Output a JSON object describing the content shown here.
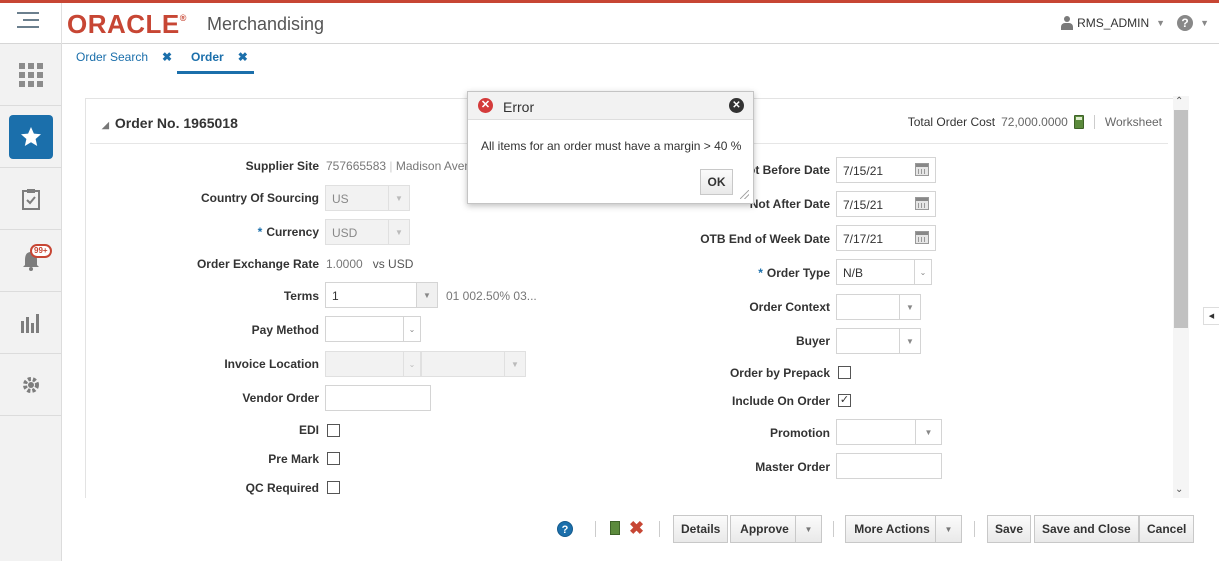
{
  "header": {
    "logo_text": "ORACLE",
    "app_name": "Merchandising",
    "user_name": "RMS_ADMIN"
  },
  "tabs": [
    {
      "label": "Order Search"
    },
    {
      "label": "Order"
    }
  ],
  "sidebar": {
    "badge": "99+"
  },
  "section": {
    "title": "Order No. 1965018",
    "total_cost_label": "Total Order Cost",
    "total_cost_value": "72,000.0000",
    "status": "Worksheet"
  },
  "form_left": {
    "supplier_site": {
      "label": "Supplier Site",
      "value": "757665583",
      "extra": "Madison Aven"
    },
    "country_of_sourcing": {
      "label": "Country Of Sourcing",
      "value": "US"
    },
    "currency": {
      "label": "Currency",
      "value": "USD",
      "required_mark": "*"
    },
    "exchange_rate": {
      "label": "Order Exchange Rate",
      "value": "1.0000",
      "suffix": "vs USD"
    },
    "terms": {
      "label": "Terms",
      "value": "1",
      "description": "01 002.50% 03..."
    },
    "pay_method": {
      "label": "Pay Method",
      "value": ""
    },
    "invoice_location": {
      "label": "Invoice Location",
      "value": ""
    },
    "vendor_order": {
      "label": "Vendor Order",
      "value": ""
    },
    "edi": {
      "label": "EDI",
      "checked": false
    },
    "pre_mark": {
      "label": "Pre Mark",
      "checked": false
    },
    "qc_required": {
      "label": "QC Required",
      "checked": false
    }
  },
  "form_right": {
    "not_before_date": {
      "label": "ot Before Date",
      "value": "7/15/21"
    },
    "not_after_date": {
      "label": "Not After Date",
      "value": "7/15/21"
    },
    "otb_eow_date": {
      "label": "OTB End of Week Date",
      "value": "7/17/21"
    },
    "order_type": {
      "label": "Order Type",
      "value": "N/B",
      "required_mark": "*"
    },
    "order_context": {
      "label": "Order Context",
      "value": ""
    },
    "buyer": {
      "label": "Buyer",
      "value": ""
    },
    "order_by_prepack": {
      "label": "Order by Prepack",
      "checked": false
    },
    "include_on_order": {
      "label": "Include On Order",
      "checked": true,
      "check_glyph": "✓"
    },
    "promotion": {
      "label": "Promotion",
      "value": ""
    },
    "master_order": {
      "label": "Master Order",
      "value": ""
    }
  },
  "actions": {
    "details": "Details",
    "approve": "Approve",
    "more_actions": "More Actions",
    "save": "Save",
    "save_and_close": "Save and Close",
    "cancel": "Cancel"
  },
  "dialog": {
    "title": "Error",
    "message": "All items for an order must have a margin > 40 %",
    "ok_label": "OK"
  },
  "colors": {
    "brand_red": "#c74634",
    "accent_blue": "#1b6fab",
    "error_red": "#d43b3b"
  }
}
